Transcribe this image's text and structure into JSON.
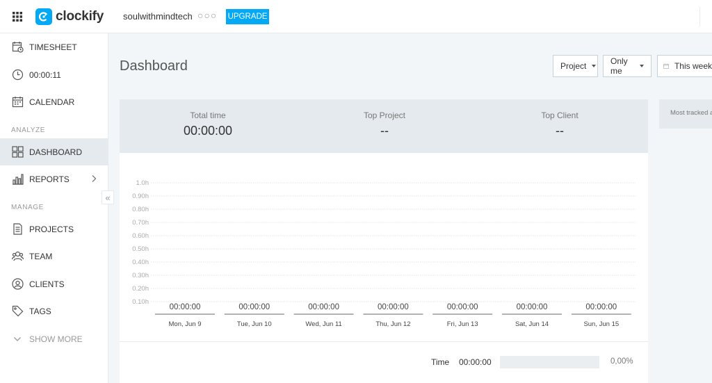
{
  "header": {
    "logo_text": "clockify",
    "workspace": "soulwithmindtech",
    "more_dots": "○○○",
    "upgrade_label": "UPGRADE"
  },
  "sidebar": {
    "items_top": [
      {
        "label": "TIMESHEET",
        "icon": "timesheet-icon"
      },
      {
        "label": "00:00:11",
        "icon": "clock-icon"
      },
      {
        "label": "CALENDAR",
        "icon": "calendar-icon"
      }
    ],
    "analyze_label": "ANALYZE",
    "analyze_items": [
      {
        "label": "DASHBOARD",
        "icon": "dashboard-icon",
        "active": true
      },
      {
        "label": "REPORTS",
        "icon": "reports-icon"
      }
    ],
    "manage_label": "MANAGE",
    "manage_items": [
      {
        "label": "PROJECTS",
        "icon": "projects-icon"
      },
      {
        "label": "TEAM",
        "icon": "team-icon"
      },
      {
        "label": "CLIENTS",
        "icon": "clients-icon"
      },
      {
        "label": "TAGS",
        "icon": "tag-icon"
      }
    ],
    "show_more_label": "SHOW MORE",
    "collapse_glyph": "«"
  },
  "main": {
    "title": "Dashboard",
    "filters": {
      "project": "Project",
      "scope": "Only me",
      "range": "This week"
    },
    "summary": {
      "total_time_label": "Total time",
      "total_time_value": "00:00:00",
      "top_project_label": "Top Project",
      "top_project_value": "--",
      "top_client_label": "Top Client",
      "top_client_value": "--"
    },
    "side_panel_text": "Most tracked activities",
    "totals": {
      "label": "Time",
      "value": "00:00:00",
      "percent": "0,00%"
    }
  },
  "chart_data": {
    "type": "bar",
    "y_ticks": [
      "1.0h",
      "0.90h",
      "0.80h",
      "0.70h",
      "0.60h",
      "0.50h",
      "0.40h",
      "0.30h",
      "0.20h",
      "0.10h"
    ],
    "ylim": [
      0,
      1.0
    ],
    "categories": [
      "Mon, Jun 9",
      "Tue, Jun 10",
      "Wed, Jun 11",
      "Thu, Jun 12",
      "Fri, Jun 13",
      "Sat, Jun 14",
      "Sun, Jun 15"
    ],
    "values": [
      0,
      0,
      0,
      0,
      0,
      0,
      0
    ],
    "data_labels": [
      "00:00:00",
      "00:00:00",
      "00:00:00",
      "00:00:00",
      "00:00:00",
      "00:00:00",
      "00:00:00"
    ],
    "grid": true,
    "colors": {
      "bar": "#03a9f4",
      "grid": "#d6dde2",
      "accent": "#03a9f4"
    }
  }
}
